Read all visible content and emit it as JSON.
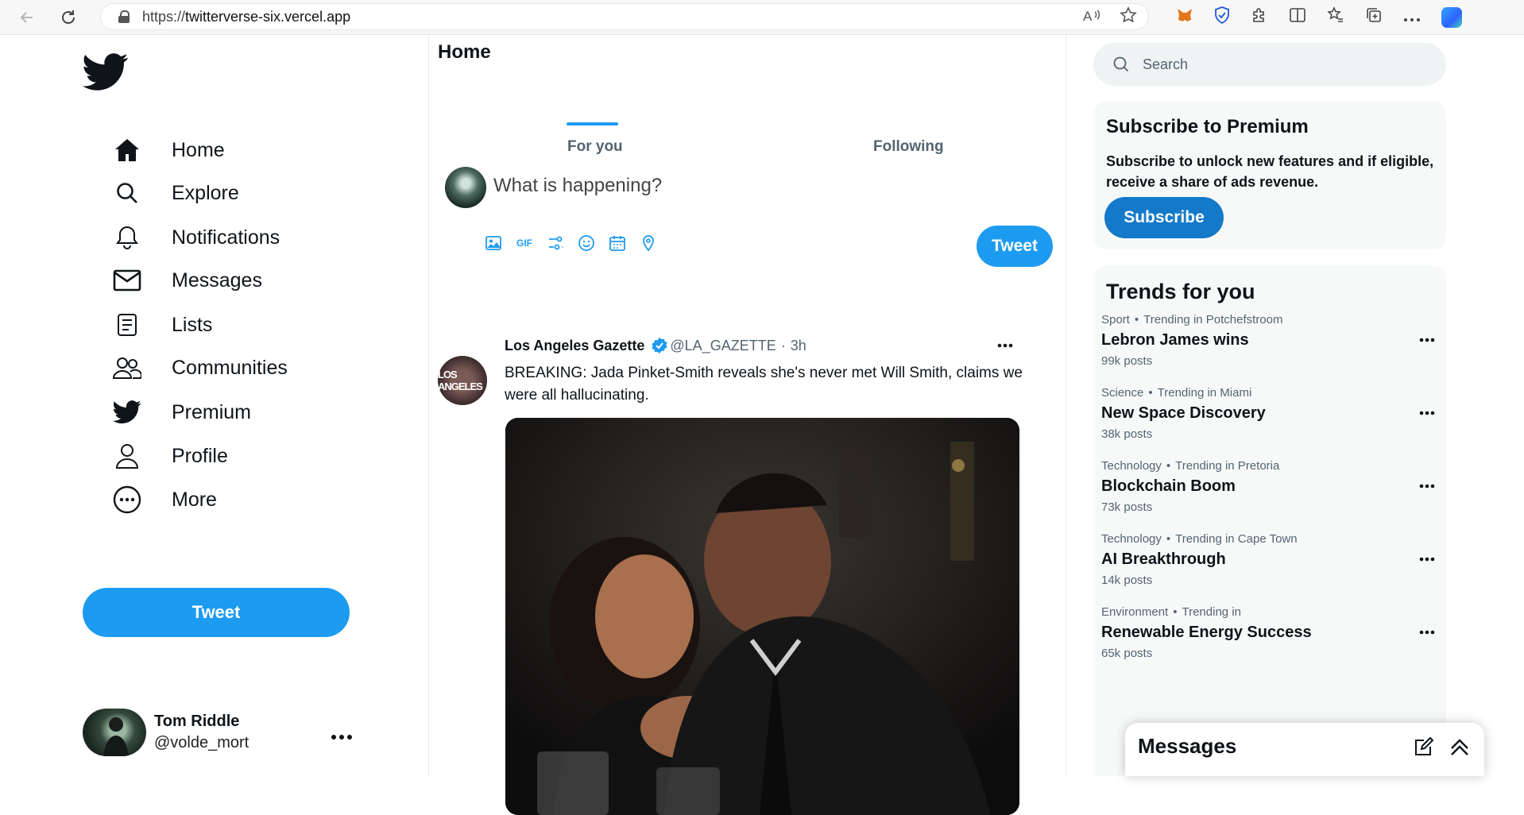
{
  "browser": {
    "url_scheme": "https://",
    "url_host": "twitterverse-six.vercel.app"
  },
  "sidebar": {
    "items": [
      {
        "label": "Home",
        "icon": "home-icon"
      },
      {
        "label": "Explore",
        "icon": "search-icon"
      },
      {
        "label": "Notifications",
        "icon": "bell-icon"
      },
      {
        "label": "Messages",
        "icon": "mail-icon"
      },
      {
        "label": "Lists",
        "icon": "list-icon"
      },
      {
        "label": "Communities",
        "icon": "people-icon"
      },
      {
        "label": "Premium",
        "icon": "twitter-bird-icon"
      },
      {
        "label": "Profile",
        "icon": "person-icon"
      },
      {
        "label": "More",
        "icon": "more-circle-icon"
      }
    ],
    "tweet_button": "Tweet",
    "account": {
      "name": "Tom Riddle",
      "handle": "@volde_mort"
    }
  },
  "main": {
    "title": "Home",
    "tabs": [
      "For you",
      "Following"
    ],
    "active_tab": "For you",
    "composer": {
      "placeholder": "What is happening?",
      "gif_label": "GIF",
      "tweet_button": "Tweet"
    },
    "post": {
      "avatar_text": "LOS ANGELES",
      "name": "Los Angeles Gazette",
      "handle": "@LA_GAZETTE",
      "separator": "·",
      "time": "3h",
      "text": "BREAKING: Jada Pinket-Smith reveals she's never met Will Smith, claims we were all hallucinating."
    }
  },
  "right": {
    "search_placeholder": "Search",
    "premium": {
      "title": "Subscribe to Premium",
      "text": "Subscribe to unlock new features and if eligible, receive a share of ads revenue.",
      "button": "Subscribe"
    },
    "trends": {
      "title": "Trends for you",
      "items": [
        {
          "category": "Sport",
          "location": "Trending in Potchefstroom",
          "name": "Lebron James wins",
          "count": "99k posts"
        },
        {
          "category": "Science",
          "location": "Trending in Miami",
          "name": "New Space Discovery",
          "count": "38k posts"
        },
        {
          "category": "Technology",
          "location": "Trending in Pretoria",
          "name": "Blockchain Boom",
          "count": "73k posts"
        },
        {
          "category": "Technology",
          "location": "Trending in Cape Town",
          "name": "AI Breakthrough",
          "count": "14k posts"
        },
        {
          "category": "Environment",
          "location": "Trending in",
          "name": "Renewable Energy Success",
          "count": "65k posts"
        }
      ],
      "separator": "•"
    },
    "messages_drawer": {
      "title": "Messages"
    }
  },
  "colors": {
    "accent": "#1d9bf0",
    "subscribe": "#1479c9",
    "muted": "#536471"
  }
}
